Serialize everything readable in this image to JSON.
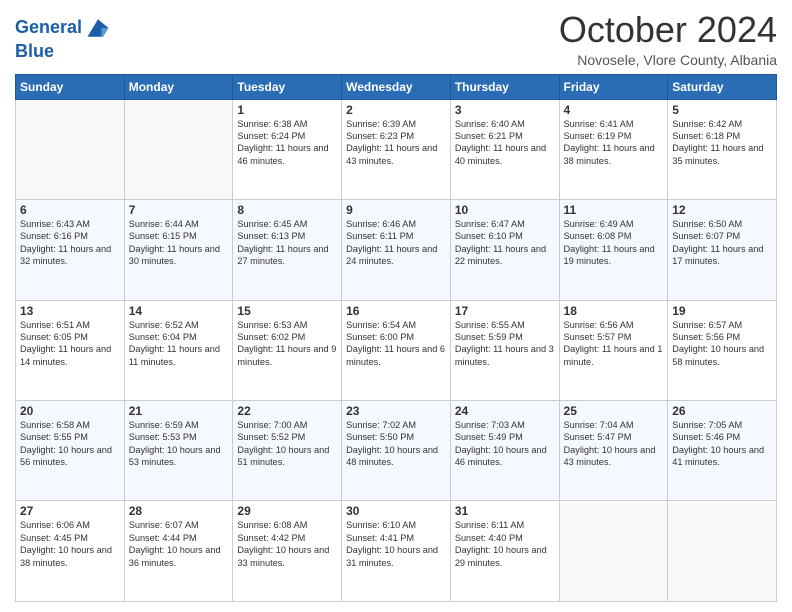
{
  "header": {
    "logo_line1": "General",
    "logo_line2": "Blue",
    "title": "October 2024",
    "subtitle": "Novosele, Vlore County, Albania"
  },
  "days_of_week": [
    "Sunday",
    "Monday",
    "Tuesday",
    "Wednesday",
    "Thursday",
    "Friday",
    "Saturday"
  ],
  "weeks": [
    [
      {
        "day": "",
        "content": ""
      },
      {
        "day": "",
        "content": ""
      },
      {
        "day": "1",
        "content": "Sunrise: 6:38 AM\nSunset: 6:24 PM\nDaylight: 11 hours and 46 minutes."
      },
      {
        "day": "2",
        "content": "Sunrise: 6:39 AM\nSunset: 6:23 PM\nDaylight: 11 hours and 43 minutes."
      },
      {
        "day": "3",
        "content": "Sunrise: 6:40 AM\nSunset: 6:21 PM\nDaylight: 11 hours and 40 minutes."
      },
      {
        "day": "4",
        "content": "Sunrise: 6:41 AM\nSunset: 6:19 PM\nDaylight: 11 hours and 38 minutes."
      },
      {
        "day": "5",
        "content": "Sunrise: 6:42 AM\nSunset: 6:18 PM\nDaylight: 11 hours and 35 minutes."
      }
    ],
    [
      {
        "day": "6",
        "content": "Sunrise: 6:43 AM\nSunset: 6:16 PM\nDaylight: 11 hours and 32 minutes."
      },
      {
        "day": "7",
        "content": "Sunrise: 6:44 AM\nSunset: 6:15 PM\nDaylight: 11 hours and 30 minutes."
      },
      {
        "day": "8",
        "content": "Sunrise: 6:45 AM\nSunset: 6:13 PM\nDaylight: 11 hours and 27 minutes."
      },
      {
        "day": "9",
        "content": "Sunrise: 6:46 AM\nSunset: 6:11 PM\nDaylight: 11 hours and 24 minutes."
      },
      {
        "day": "10",
        "content": "Sunrise: 6:47 AM\nSunset: 6:10 PM\nDaylight: 11 hours and 22 minutes."
      },
      {
        "day": "11",
        "content": "Sunrise: 6:49 AM\nSunset: 6:08 PM\nDaylight: 11 hours and 19 minutes."
      },
      {
        "day": "12",
        "content": "Sunrise: 6:50 AM\nSunset: 6:07 PM\nDaylight: 11 hours and 17 minutes."
      }
    ],
    [
      {
        "day": "13",
        "content": "Sunrise: 6:51 AM\nSunset: 6:05 PM\nDaylight: 11 hours and 14 minutes."
      },
      {
        "day": "14",
        "content": "Sunrise: 6:52 AM\nSunset: 6:04 PM\nDaylight: 11 hours and 11 minutes."
      },
      {
        "day": "15",
        "content": "Sunrise: 6:53 AM\nSunset: 6:02 PM\nDaylight: 11 hours and 9 minutes."
      },
      {
        "day": "16",
        "content": "Sunrise: 6:54 AM\nSunset: 6:00 PM\nDaylight: 11 hours and 6 minutes."
      },
      {
        "day": "17",
        "content": "Sunrise: 6:55 AM\nSunset: 5:59 PM\nDaylight: 11 hours and 3 minutes."
      },
      {
        "day": "18",
        "content": "Sunrise: 6:56 AM\nSunset: 5:57 PM\nDaylight: 11 hours and 1 minute."
      },
      {
        "day": "19",
        "content": "Sunrise: 6:57 AM\nSunset: 5:56 PM\nDaylight: 10 hours and 58 minutes."
      }
    ],
    [
      {
        "day": "20",
        "content": "Sunrise: 6:58 AM\nSunset: 5:55 PM\nDaylight: 10 hours and 56 minutes."
      },
      {
        "day": "21",
        "content": "Sunrise: 6:59 AM\nSunset: 5:53 PM\nDaylight: 10 hours and 53 minutes."
      },
      {
        "day": "22",
        "content": "Sunrise: 7:00 AM\nSunset: 5:52 PM\nDaylight: 10 hours and 51 minutes."
      },
      {
        "day": "23",
        "content": "Sunrise: 7:02 AM\nSunset: 5:50 PM\nDaylight: 10 hours and 48 minutes."
      },
      {
        "day": "24",
        "content": "Sunrise: 7:03 AM\nSunset: 5:49 PM\nDaylight: 10 hours and 46 minutes."
      },
      {
        "day": "25",
        "content": "Sunrise: 7:04 AM\nSunset: 5:47 PM\nDaylight: 10 hours and 43 minutes."
      },
      {
        "day": "26",
        "content": "Sunrise: 7:05 AM\nSunset: 5:46 PM\nDaylight: 10 hours and 41 minutes."
      }
    ],
    [
      {
        "day": "27",
        "content": "Sunrise: 6:06 AM\nSunset: 4:45 PM\nDaylight: 10 hours and 38 minutes."
      },
      {
        "day": "28",
        "content": "Sunrise: 6:07 AM\nSunset: 4:44 PM\nDaylight: 10 hours and 36 minutes."
      },
      {
        "day": "29",
        "content": "Sunrise: 6:08 AM\nSunset: 4:42 PM\nDaylight: 10 hours and 33 minutes."
      },
      {
        "day": "30",
        "content": "Sunrise: 6:10 AM\nSunset: 4:41 PM\nDaylight: 10 hours and 31 minutes."
      },
      {
        "day": "31",
        "content": "Sunrise: 6:11 AM\nSunset: 4:40 PM\nDaylight: 10 hours and 29 minutes."
      },
      {
        "day": "",
        "content": ""
      },
      {
        "day": "",
        "content": ""
      }
    ]
  ]
}
